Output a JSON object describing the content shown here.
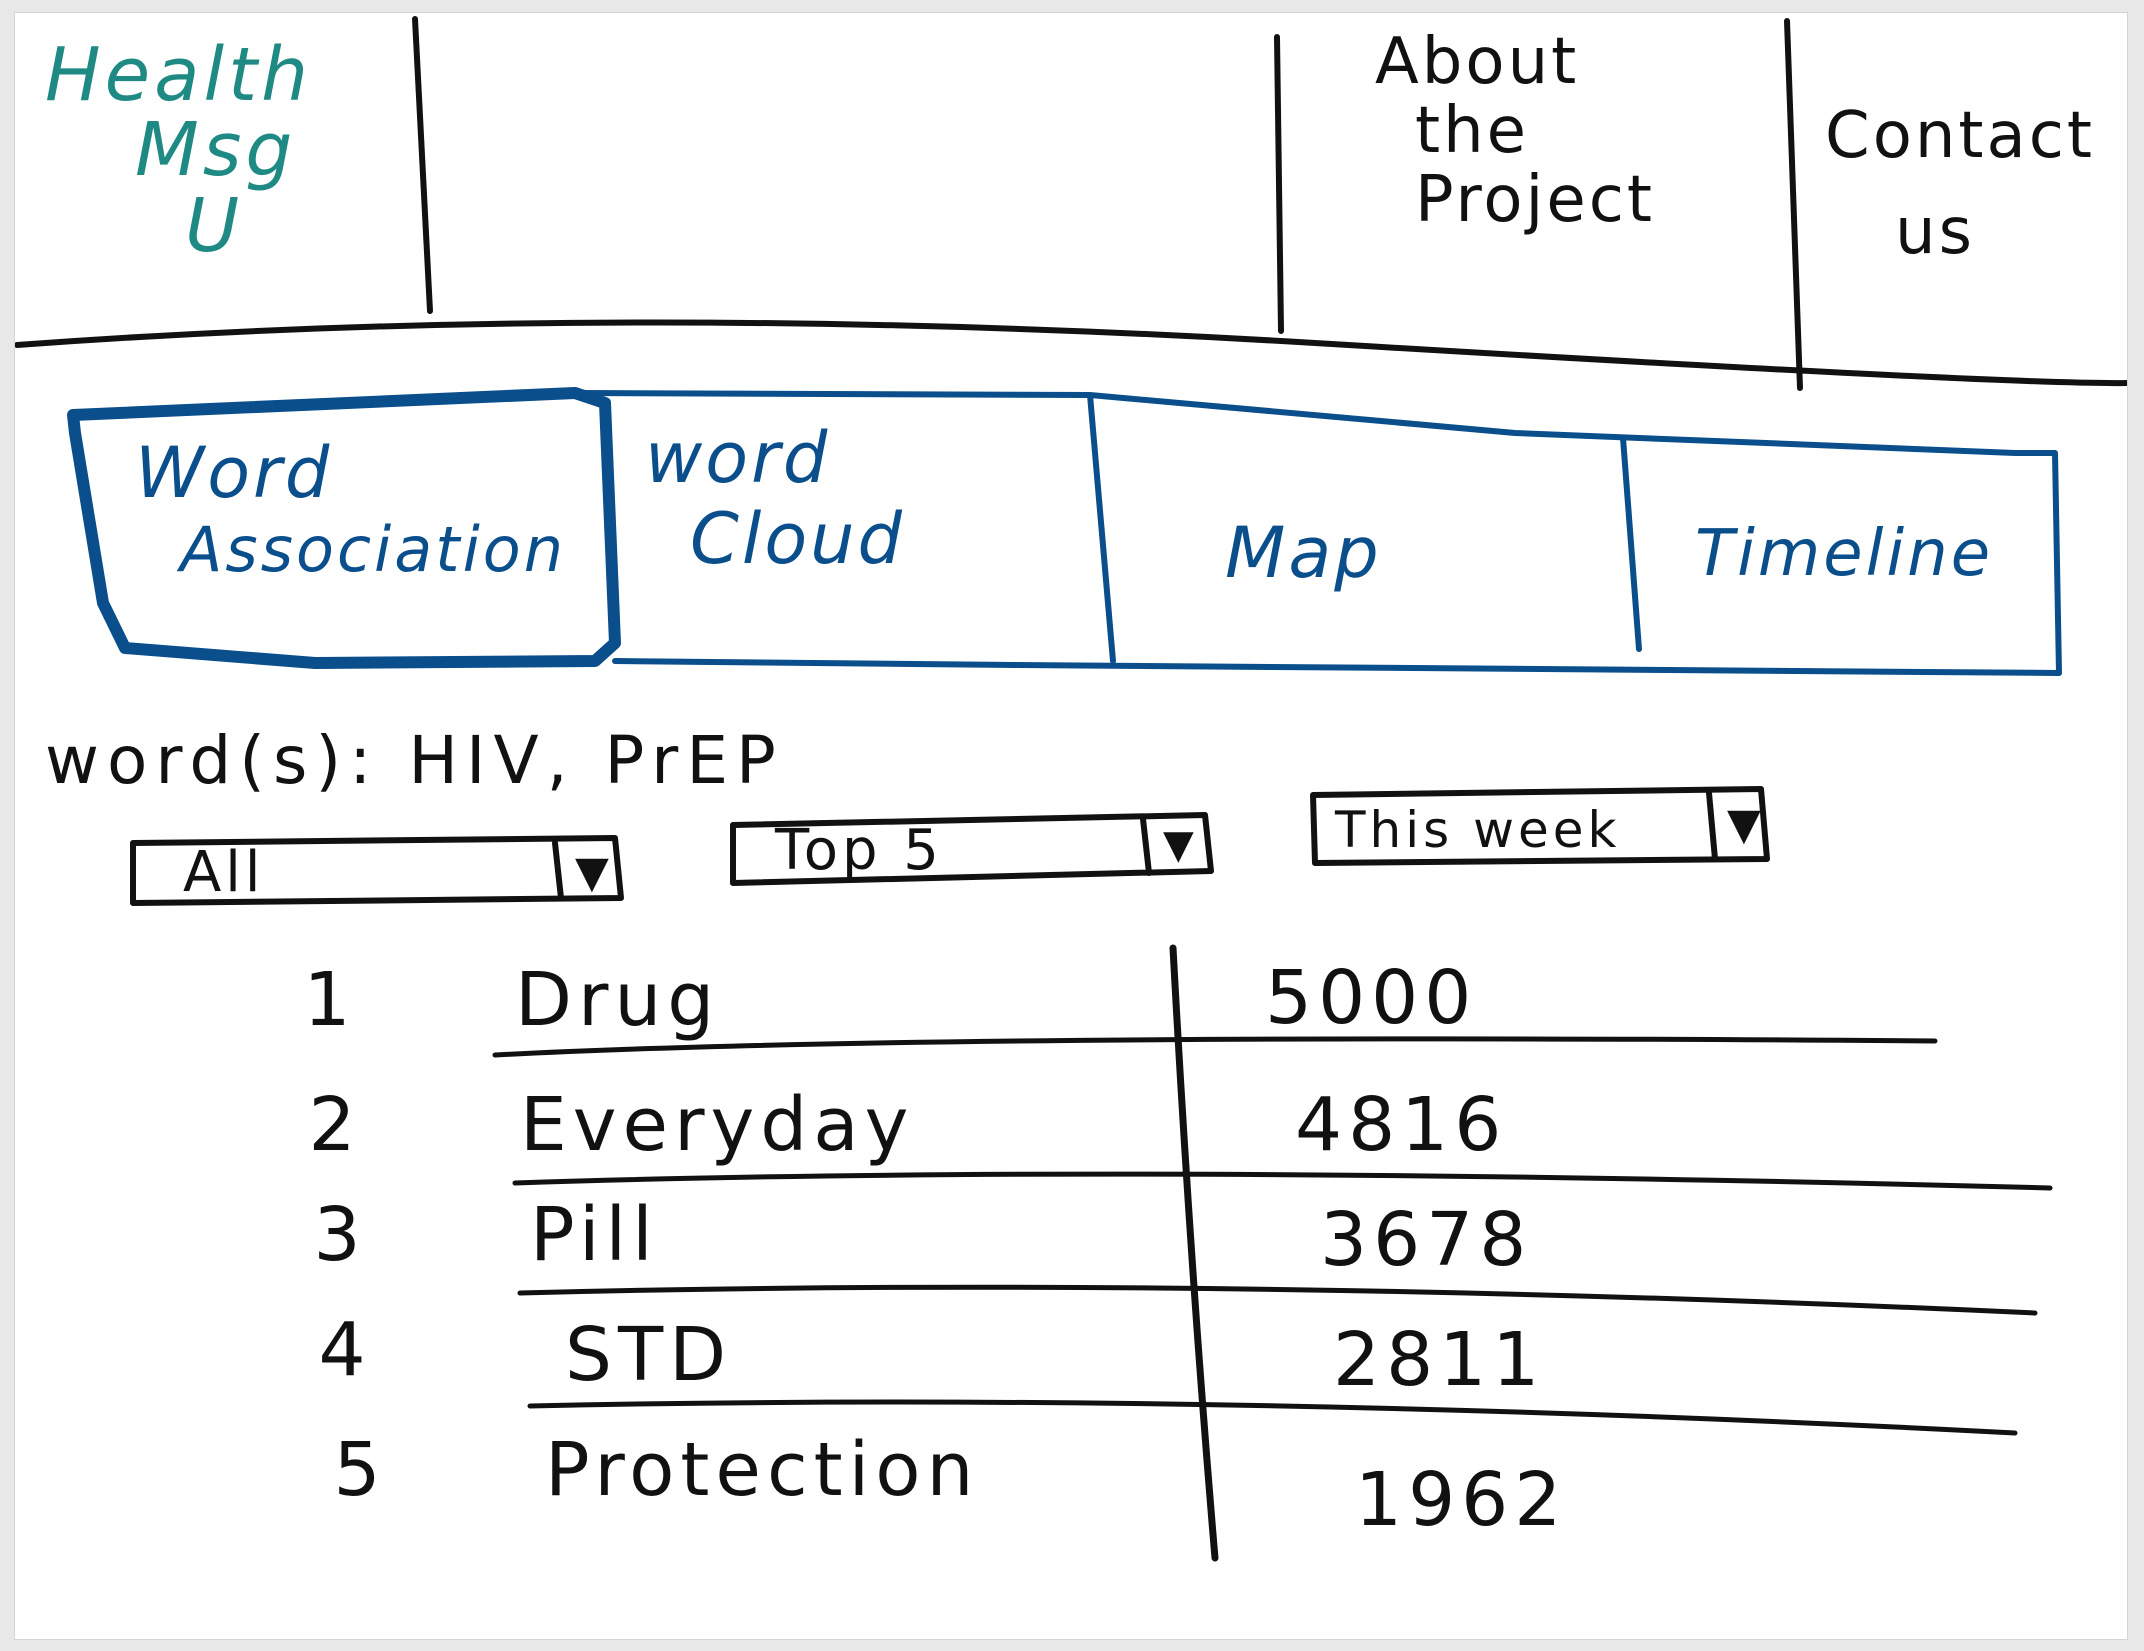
{
  "colors": {
    "nav_logo": "#1f8a84",
    "tab_outline": "#0a4e8c",
    "ink": "#111111"
  },
  "nav": {
    "logo_lines": [
      "Health",
      "Msg",
      "U"
    ],
    "about_lines": [
      "About",
      "the",
      "Project"
    ],
    "contact_lines": [
      "Contact",
      "us"
    ]
  },
  "tabs": {
    "active": "Word Association",
    "items": [
      {
        "lines": [
          "Word",
          "Association"
        ]
      },
      {
        "lines": [
          "word",
          "Cloud"
        ]
      },
      {
        "lines": [
          "Map"
        ]
      },
      {
        "lines": [
          "Timeline"
        ]
      }
    ]
  },
  "filters": {
    "words_label": "word(s):",
    "words_value": "HIV, PrEP",
    "dropdowns": [
      {
        "selected": "All",
        "icon": "chevron-down-icon"
      },
      {
        "selected": "Top 5",
        "icon": "chevron-down-icon"
      },
      {
        "selected": "This week",
        "icon": "chevron-down-icon"
      }
    ]
  },
  "results": {
    "rows": [
      {
        "rank": "1",
        "word": "Drug",
        "count": "5000"
      },
      {
        "rank": "2",
        "word": "Everyday",
        "count": "4816"
      },
      {
        "rank": "3",
        "word": "Pill",
        "count": "3678"
      },
      {
        "rank": "4",
        "word": "STD",
        "count": "2811"
      },
      {
        "rank": "5",
        "word": "Protection",
        "count": "1962"
      }
    ]
  }
}
